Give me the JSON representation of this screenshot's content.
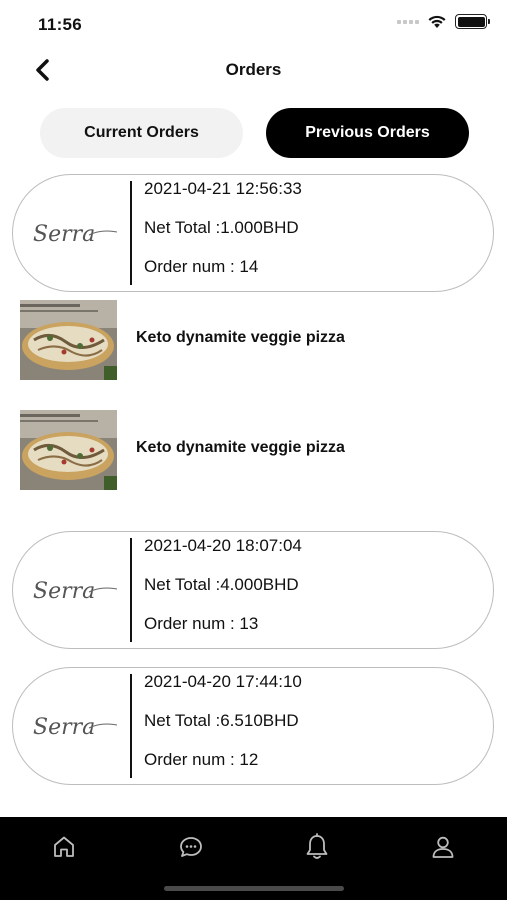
{
  "status_bar": {
    "time": "11:56"
  },
  "header": {
    "title": "Orders"
  },
  "tabs": [
    {
      "label": "Current Orders",
      "active": false
    },
    {
      "label": "Previous Orders",
      "active": true
    }
  ],
  "orders": [
    {
      "brand": "Serra",
      "date": "2021-04-21 12:56:33",
      "net_total": "Net Total :1.000BHD",
      "order_num": "Order num : 14"
    },
    {
      "brand": "Serra",
      "date": "2021-04-20 18:07:04",
      "net_total": "Net Total :4.000BHD",
      "order_num": "Order num : 13"
    },
    {
      "brand": "Serra",
      "date": "2021-04-20 17:44:10",
      "net_total": "Net Total :6.510BHD",
      "order_num": "Order num : 12"
    }
  ],
  "items": [
    {
      "name": "Keto dynamite veggie pizza"
    },
    {
      "name": "Keto dynamite veggie pizza"
    }
  ],
  "bottom_nav": [
    {
      "icon": "home-icon"
    },
    {
      "icon": "chat-icon"
    },
    {
      "icon": "bell-icon"
    },
    {
      "icon": "profile-icon"
    }
  ],
  "colors": {
    "active_tab_bg": "#000000",
    "inactive_tab_bg": "#f2f2f2",
    "nav_bg": "#000000",
    "card_border": "#bdbdbd"
  }
}
